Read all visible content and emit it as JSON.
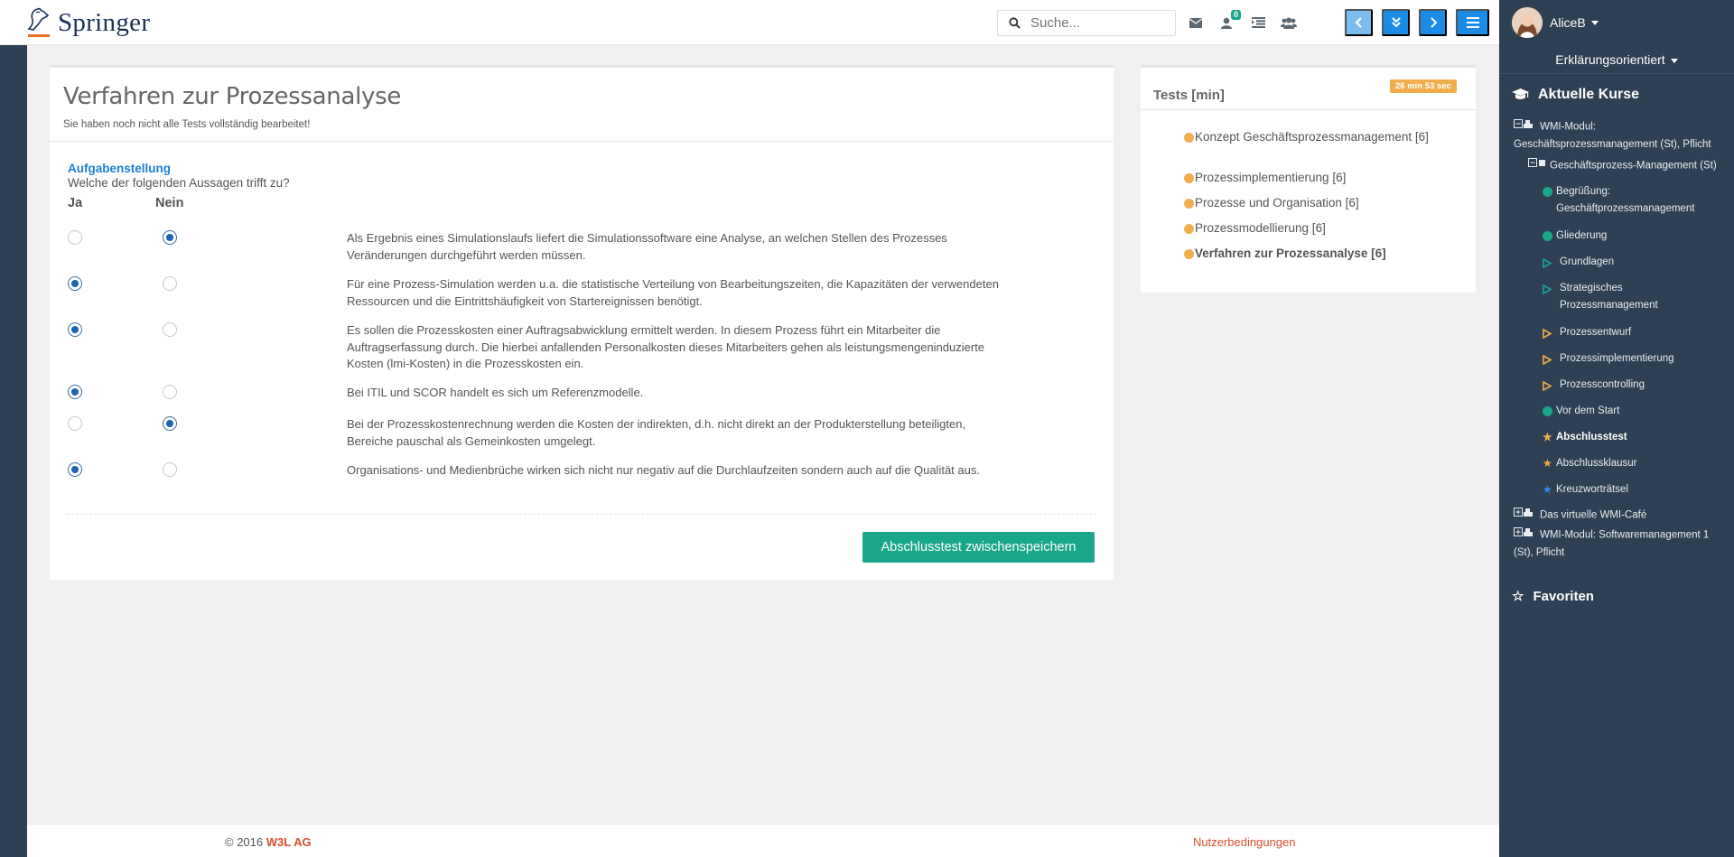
{
  "brand": {
    "name": "Springer"
  },
  "search": {
    "placeholder": "Suche..."
  },
  "header": {
    "icons": [
      "envelope-icon",
      "user-notification-icon",
      "list-indent-icon",
      "group-icon"
    ],
    "notification_count": "0",
    "nav_buttons": [
      "previous",
      "expand-down",
      "next",
      "menu"
    ]
  },
  "user": {
    "name": "AliceB",
    "mode": "Erklärungsorientiert"
  },
  "sidebar": {
    "current_courses_title": "Aktuelle Kurse",
    "favorites_title": "Favoriten",
    "tree": [
      {
        "label": "WMI-Modul: Geschäftsprozessmanagement (St), Pflicht",
        "level": 0,
        "icon": "collapse-cubes-icon"
      },
      {
        "label": "Geschäftsprozess-Management (St)",
        "level": 1,
        "icon": "collapse-cube-icon"
      },
      {
        "label": "Begrüßung: Geschäftprozessmanagement",
        "level": 2,
        "icon": "green-dot"
      },
      {
        "label": "Gliederung",
        "level": 2,
        "icon": "green-dot"
      },
      {
        "label": "Grundlagen",
        "level": 2,
        "icon": "green-play-outline"
      },
      {
        "label": "Strategisches Prozessmanagement",
        "level": 2,
        "icon": "green-play-outline"
      },
      {
        "label": "Prozessentwurf",
        "level": 2,
        "icon": "orange-play-outline"
      },
      {
        "label": "Prozessimplementierung",
        "level": 2,
        "icon": "orange-play-outline"
      },
      {
        "label": "Prozesscontrolling",
        "level": 2,
        "icon": "orange-play-outline"
      },
      {
        "label": "Vor dem Start",
        "level": 2,
        "icon": "green-dot"
      },
      {
        "label": "Abschlusstest",
        "level": 2,
        "icon": "orange-star",
        "active": true
      },
      {
        "label": "Abschlussklausur",
        "level": 2,
        "icon": "orange-star"
      },
      {
        "label": "Kreuzworträtsel",
        "level": 2,
        "icon": "blue-star"
      },
      {
        "label": "Das virtuelle WMI-Café",
        "level": 0,
        "icon": "expand-cubes-icon"
      },
      {
        "label": "WMI-Modul: Softwaremanagement 1 (St), Pflicht",
        "level": 0,
        "icon": "expand-cubes-icon"
      }
    ]
  },
  "main": {
    "title": "Verfahren zur Prozessanalyse",
    "subtitle": "Sie haben noch nicht alle Tests vollständig bearbeitet!",
    "task_label": "Aufgabenstellung",
    "question": "Welche der folgenden Aussagen trifft zu?",
    "col_yes": "Ja",
    "col_no": "Nein",
    "statements": [
      {
        "text": "Als Ergebnis eines Simulationslaufs liefert die Simulationssoftware eine Analyse, an welchen Stellen des Prozesses Veränderungen durchgeführt werden müssen.",
        "answer": "no"
      },
      {
        "text": "Für eine Prozess-Simulation werden u.a. die statistische Verteilung von Bearbeitungszeiten, die Kapazitäten der verwendeten Ressourcen und die Eintrittshäufigkeit von Startereignissen benötigt.",
        "answer": "yes"
      },
      {
        "text": "Es sollen die Prozesskosten einer Auftragsabwicklung ermittelt werden. In diesem Prozess führt ein Mitarbeiter die Auftragserfassung durch. Die hierbei anfallenden Personalkosten dieses Mitarbeiters gehen als leistungsmengeninduzierte Kosten (lmi-Kosten) in die Prozesskosten ein.",
        "answer": "yes"
      },
      {
        "text": "Bei ITIL und SCOR handelt es sich um Referenzmodelle.",
        "answer": "yes"
      },
      {
        "text": "Bei der Prozesskostenrechnung werden die Kosten der indirekten, d.h. nicht direkt an der Produkterstellung beteiligten, Bereiche pauschal als Gemeinkosten umgelegt.",
        "answer": "no"
      },
      {
        "text": "Organisations- und Medienbrüche wirken sich nicht nur negativ auf die Durchlaufzeiten sondern auch auf die Qualität aus.",
        "answer": "yes"
      }
    ],
    "save_label": "Abschlusstest zwischenspeichern"
  },
  "tests_panel": {
    "title": "Tests [min]",
    "timer": "26 min 53 sec",
    "items": [
      {
        "label": "Konzept Geschäftsprozessmanagement [6]",
        "current": false
      },
      {
        "label": "Prozessimplementierung [6]",
        "current": false
      },
      {
        "label": "Prozesse und Organisation [6]",
        "current": false
      },
      {
        "label": "Prozessmodellierung [6]",
        "current": false
      },
      {
        "label": "Verfahren zur Prozessanalyse [6]",
        "current": true
      }
    ]
  },
  "footer": {
    "copyright": "© 2016",
    "company": "W3L AG",
    "terms": "Nutzerbedingungen"
  },
  "colors": {
    "accent": "#1aa68b",
    "primary": "#1b8ce6",
    "sidebar": "#2e4053",
    "warning": "#f0ad4e",
    "link": "#d64f2e"
  }
}
